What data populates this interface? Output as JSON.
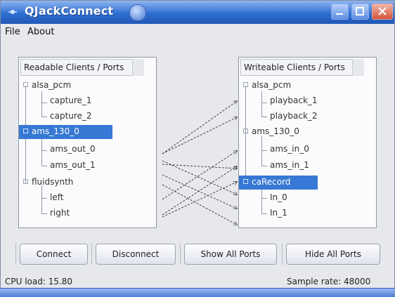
{
  "window": {
    "title": "QJackConnect"
  },
  "menu": [
    {
      "label": "File"
    },
    {
      "label": "About"
    }
  ],
  "readable_panel": {
    "header": "Readable Clients / Ports",
    "rows": [
      {
        "label": "alsa_pcm",
        "level": 0,
        "selected": false
      },
      {
        "label": "capture_1",
        "level": 1,
        "selected": false
      },
      {
        "label": "capture_2",
        "level": 1,
        "selected": false
      },
      {
        "label": "ams_130_0",
        "level": 0,
        "selected": true
      },
      {
        "label": "ams_out_0",
        "level": 1,
        "selected": false
      },
      {
        "label": "ams_out_1",
        "level": 1,
        "selected": false
      },
      {
        "label": "fluidsynth",
        "level": 0,
        "selected": false
      },
      {
        "label": "left",
        "level": 1,
        "selected": false
      },
      {
        "label": "right",
        "level": 1,
        "selected": false
      }
    ]
  },
  "writable_panel": {
    "header": "Writeable Clients / Ports",
    "rows": [
      {
        "label": "alsa_pcm",
        "level": 0,
        "selected": false
      },
      {
        "label": "playback_1",
        "level": 1,
        "selected": false
      },
      {
        "label": "playback_2",
        "level": 1,
        "selected": false
      },
      {
        "label": "ams_130_0",
        "level": 0,
        "selected": false
      },
      {
        "label": "ams_in_0",
        "level": 1,
        "selected": false
      },
      {
        "label": "ams_in_1",
        "level": 1,
        "selected": false
      },
      {
        "label": "caRecord",
        "level": 0,
        "selected": true
      },
      {
        "label": "In_0",
        "level": 1,
        "selected": false
      },
      {
        "label": "In_1",
        "level": 1,
        "selected": false
      }
    ]
  },
  "buttons": {
    "connect": "Connect",
    "disconnect": "Disconnect",
    "show_all": "Show All Ports",
    "hide_all": "Hide All Ports"
  },
  "status": {
    "cpu": "CPU load: 15.80",
    "sample_rate": "Sample rate: 48000"
  },
  "colors": {
    "title_bar": "#2f6fd1",
    "selection": "#3678d3"
  }
}
